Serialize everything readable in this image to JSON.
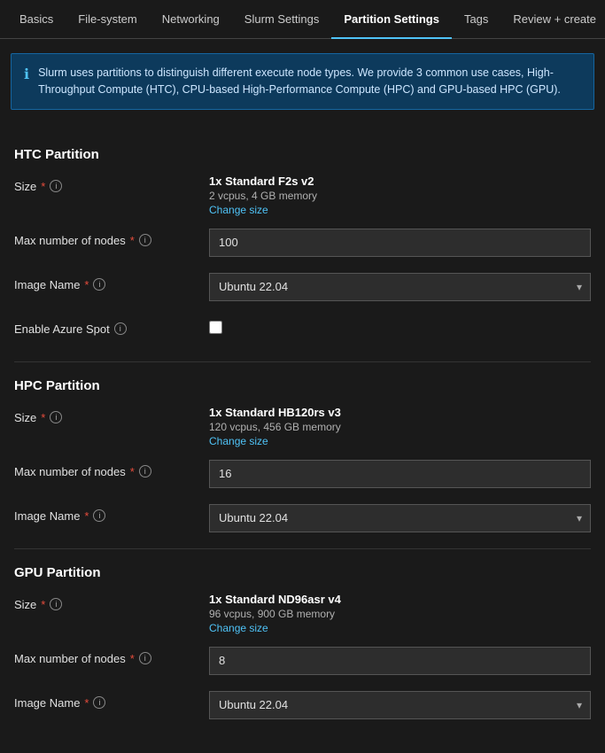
{
  "nav": {
    "tabs": [
      {
        "id": "basics",
        "label": "Basics",
        "active": false
      },
      {
        "id": "filesystem",
        "label": "File-system",
        "active": false
      },
      {
        "id": "networking",
        "label": "Networking",
        "active": false
      },
      {
        "id": "slurm",
        "label": "Slurm Settings",
        "active": false
      },
      {
        "id": "partition",
        "label": "Partition Settings",
        "active": true
      },
      {
        "id": "tags",
        "label": "Tags",
        "active": false
      },
      {
        "id": "review",
        "label": "Review + create",
        "active": false
      }
    ]
  },
  "banner": {
    "text": "Slurm uses partitions to distinguish different execute node types. We provide 3 common use cases, High-Throughput Compute (HTC), CPU-based High-Performance Compute (HPC) and GPU-based HPC (GPU)."
  },
  "htc": {
    "header": "HTC Partition",
    "size_label": "Size",
    "size_name": "1x Standard F2s v2",
    "size_specs": "2 vcpus, 4 GB memory",
    "change_size": "Change size",
    "max_nodes_label": "Max number of nodes",
    "max_nodes_value": "100",
    "image_label": "Image Name",
    "image_value": "Ubuntu 22.04",
    "azure_spot_label": "Enable Azure Spot"
  },
  "hpc": {
    "header": "HPC Partition",
    "size_label": "Size",
    "size_name": "1x Standard HB120rs v3",
    "size_specs": "120 vcpus, 456 GB memory",
    "change_size": "Change size",
    "max_nodes_label": "Max number of nodes",
    "max_nodes_value": "16",
    "image_label": "Image Name",
    "image_value": "Ubuntu 22.04"
  },
  "gpu": {
    "header": "GPU Partition",
    "size_label": "Size",
    "size_name": "1x Standard ND96asr v4",
    "size_specs": "96 vcpus, 900 GB memory",
    "change_size": "Change size",
    "max_nodes_label": "Max number of nodes",
    "max_nodes_value": "8",
    "image_label": "Image Name",
    "image_value": "Ubuntu 22.04"
  },
  "labels": {
    "required_asterisk": "*",
    "chevron_down": "▾"
  },
  "colors": {
    "active_tab_underline": "#4fc3f7",
    "link_color": "#4fc3f7",
    "required_color": "#e74c3c"
  }
}
